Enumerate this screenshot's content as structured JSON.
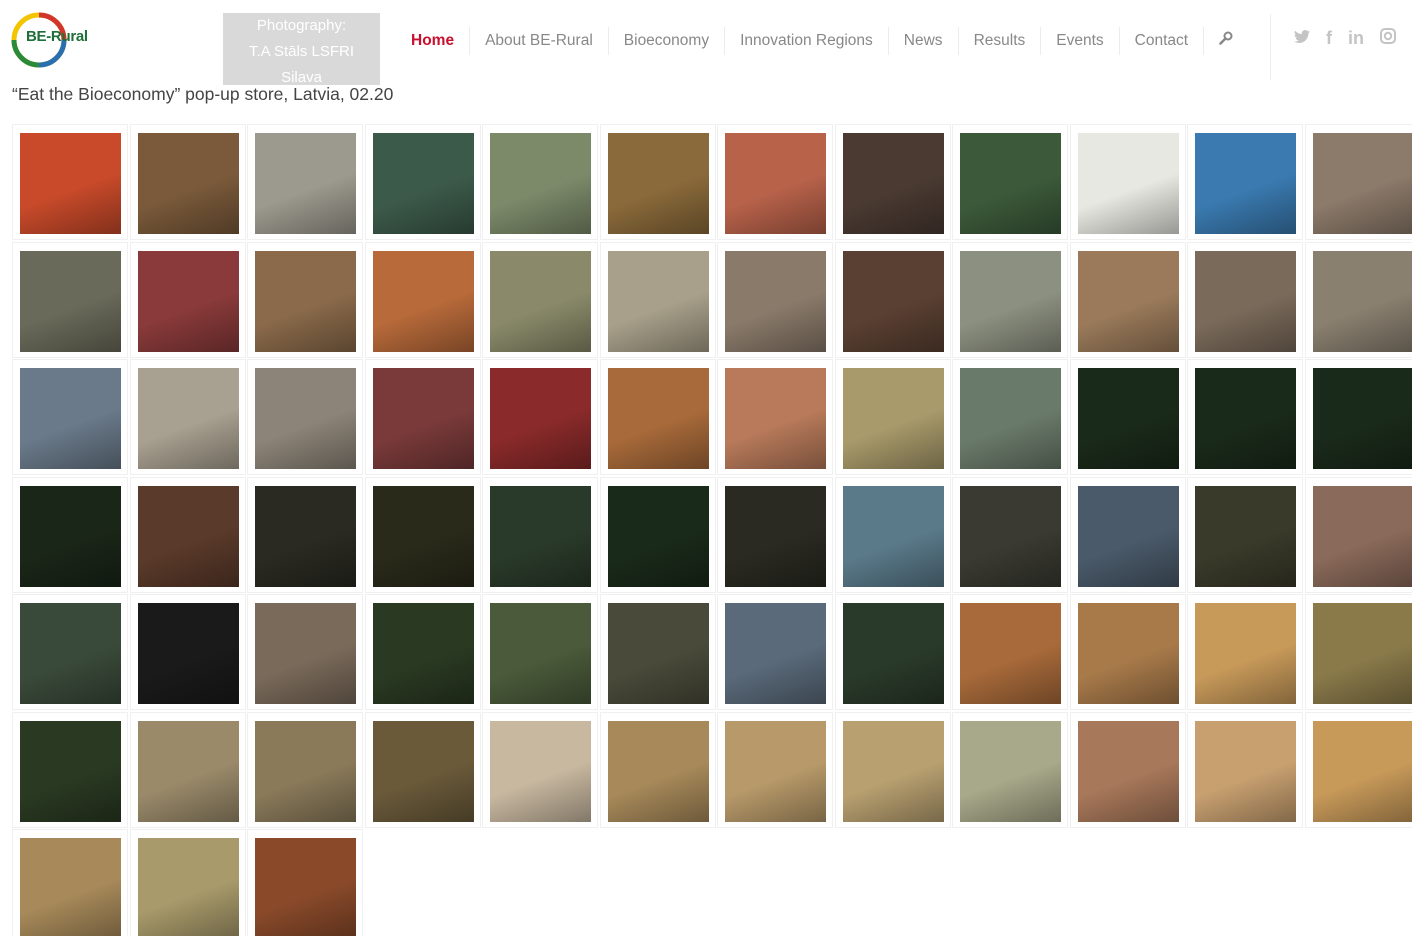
{
  "header": {
    "logo_text": "BE-Rural",
    "photo_credit_lines": [
      "Photography:",
      "T.A Stāls LSFRI",
      "Silava"
    ],
    "nav": [
      "Home",
      "About BE-Rural",
      "Bioeconomy",
      "Innovation Regions",
      "News",
      "Results",
      "Events",
      "Contact"
    ],
    "active_nav_index": 0,
    "search_icon": "wrench-search-icon",
    "social": [
      {
        "name": "twitter",
        "glyph": "🐦"
      },
      {
        "name": "facebook",
        "glyph": "f"
      },
      {
        "name": "linkedin",
        "glyph": "in"
      },
      {
        "name": "instagram",
        "glyph": "◎"
      }
    ]
  },
  "caption": "“Eat the Bioeconomy” pop-up store, Latvia, 02.20",
  "gallery": {
    "columns": 12,
    "rows": [
      [
        "#c84a2a",
        "#7a5a3a",
        "#9c9a8e",
        "#3c5a4a",
        "#7c8a6a",
        "#8a6a3a",
        "#b8624a",
        "#4a3a32",
        "#3c5a3a",
        "#e8e8e2",
        "#3a7ab0",
        "#8c7a6a"
      ],
      [
        "#6a6a5a",
        "#8a3a3a",
        "#8a6a4a",
        "#b86a3a",
        "#8a8a6a",
        "#a8a08a",
        "#8a7a6a",
        "#5a4032",
        "#8c9080",
        "#9a7a5a",
        "#7a6a5a",
        "#8a8070"
      ],
      [
        "#6a7a8a",
        "#a8a090",
        "#8c8478",
        "#7a3a3a",
        "#8a2a2a",
        "#a86a3a",
        "#b87a5a",
        "#a89a6a",
        "#6a7a6a",
        "#1a2a1a",
        "#1a2a1a",
        "#1a2a1a"
      ],
      [
        "#1a2618",
        "#5a3a2a",
        "#2a2a22",
        "#2a2a1a",
        "#2a3a2a",
        "#1a2a1a",
        "#2a2a22",
        "#5a7a8a",
        "#3a3a32",
        "#4a5a6a",
        "#3a3a2a",
        "#8a6a5a"
      ],
      [
        "#3a4a3a",
        "#1a1a1a",
        "#7a6a5a",
        "#2a3a22",
        "#4a5a3a",
        "#4a4a3a",
        "#5a6a7a",
        "#2a3a2a",
        "#a86a3a",
        "#a87a4a",
        "#c89a5a",
        "#8a7a4a"
      ],
      [
        "#2a3a22",
        "#9a8a6a",
        "#8a7a5a",
        "#6a5a3a",
        "#c8b8a0",
        "#a88a5a",
        "#b89a6a",
        "#b8a070",
        "#a8a88a",
        "#a8785a",
        "#c8a070",
        "#c89a5a"
      ],
      [
        "#a88a5a",
        "#a89a6a",
        "#8a4a2a"
      ]
    ]
  }
}
